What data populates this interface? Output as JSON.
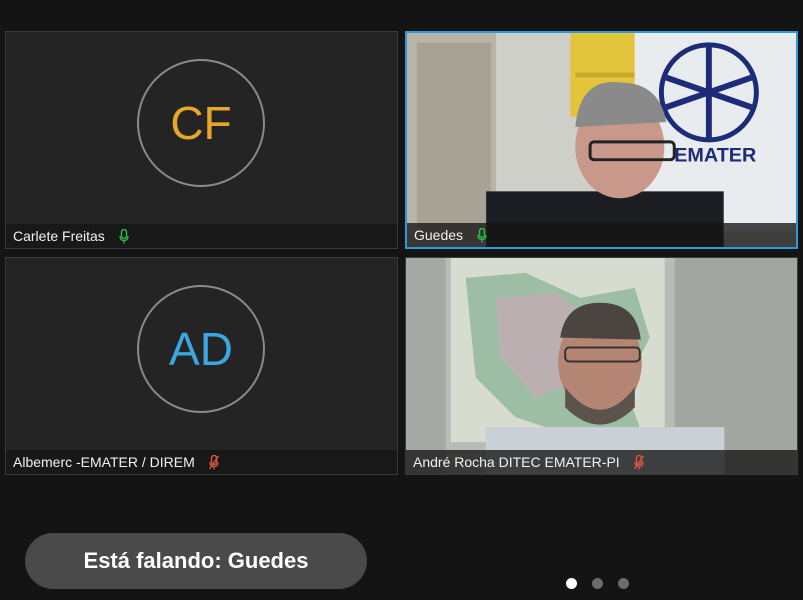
{
  "participants": [
    {
      "name": "Carlete Freitas",
      "initials": "CF",
      "initials_color": "#e8a827",
      "mic": "unmuted",
      "mic_color": "#27c24c"
    },
    {
      "name": "Guedes",
      "mic": "unmuted",
      "mic_color": "#27c24c",
      "active_speaker": true,
      "logo_text": "EMATER"
    },
    {
      "name": "Albemerc -EMATER / DIREM",
      "initials": "AD",
      "initials_color": "#3ba6e0",
      "mic": "muted",
      "mic_color": "#e0553d"
    },
    {
      "name": "André Rocha DITEC EMATER-PI",
      "mic": "muted",
      "mic_color": "#e0553d"
    }
  ],
  "speaking_banner": "Está falando: Guedes",
  "pagination": {
    "pages": 3,
    "current": 1
  }
}
